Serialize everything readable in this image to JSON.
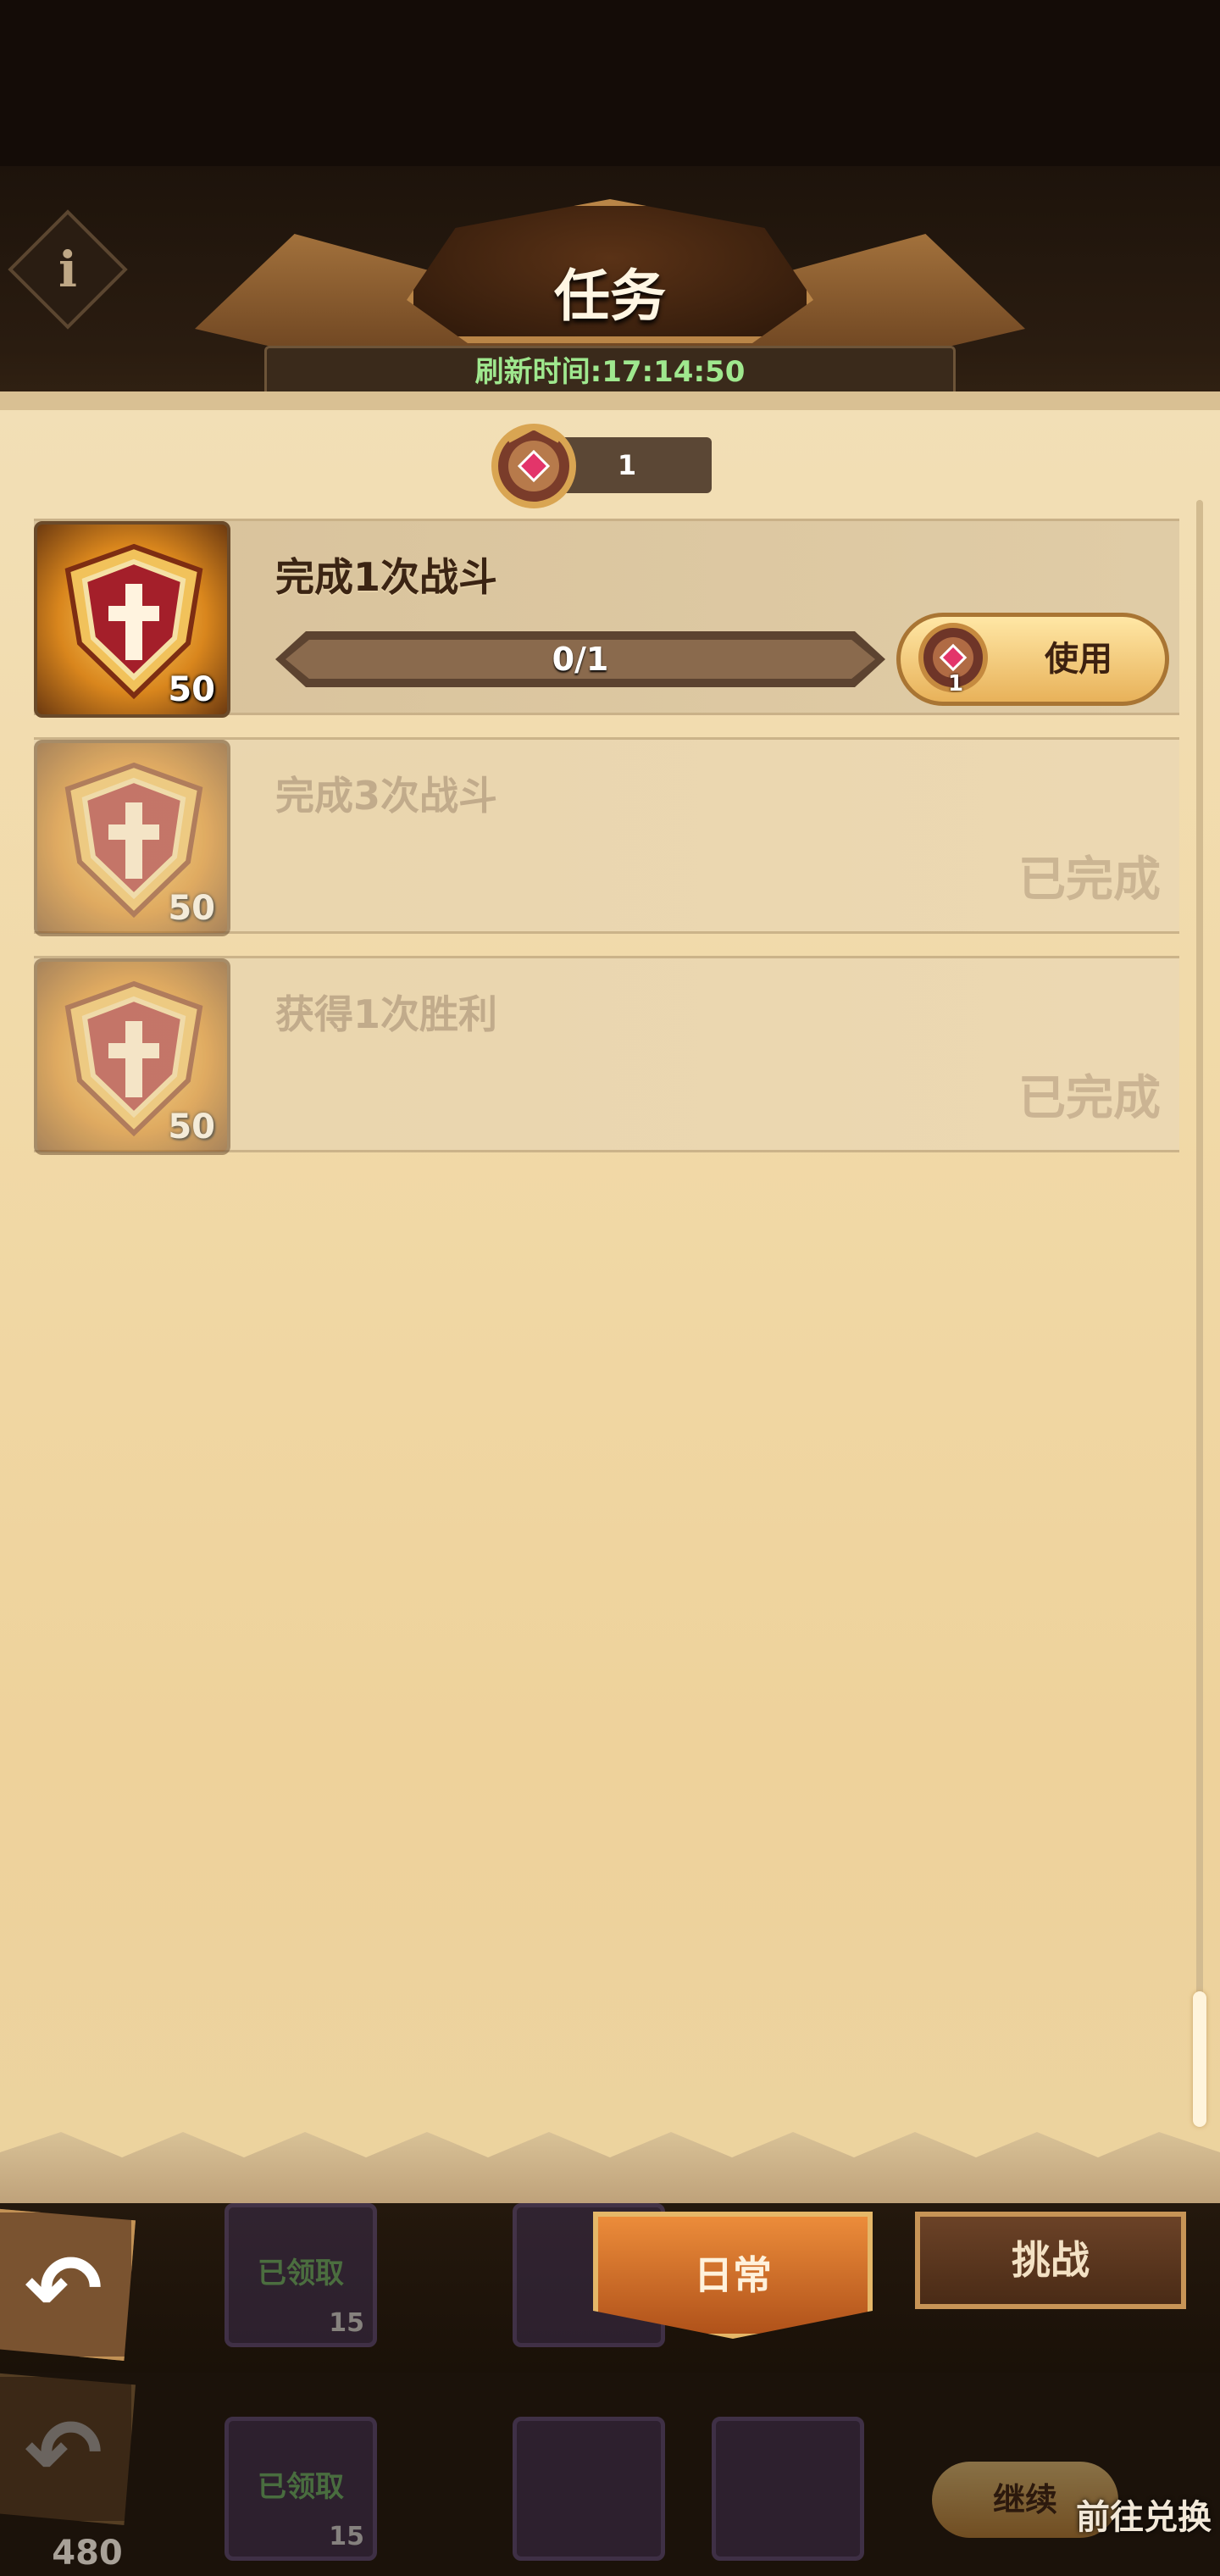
{
  "header": {
    "title": "任务",
    "refresh_time": "刷新时间:17:14:50",
    "info_icon": "i"
  },
  "medal_counter": {
    "count": "1",
    "icon": "medal-icon"
  },
  "tasks": [
    {
      "title": "完成1次战斗",
      "reward_count": "50",
      "progress_text": "0/1",
      "progress": 0,
      "action": {
        "label": "使用",
        "badge": "1"
      },
      "status": ""
    },
    {
      "title": "完成3次战斗",
      "reward_count": "50",
      "status": "已完成"
    },
    {
      "title": "获得1次胜利",
      "reward_count": "50",
      "status": "已完成"
    }
  ],
  "bottom_tabs": {
    "daily": "日常",
    "challenge": "挑战"
  },
  "background_items": {
    "claimed_label": "已领取",
    "claimed_count": "15",
    "continue_label": "继续",
    "exchange_label": "前往兑换",
    "score": "480"
  },
  "colors": {
    "parchment": "#f1d9a7",
    "refresh_text": "#9fe88e",
    "tab_active": "#d26a26",
    "tab_inactive": "#5a361d"
  }
}
